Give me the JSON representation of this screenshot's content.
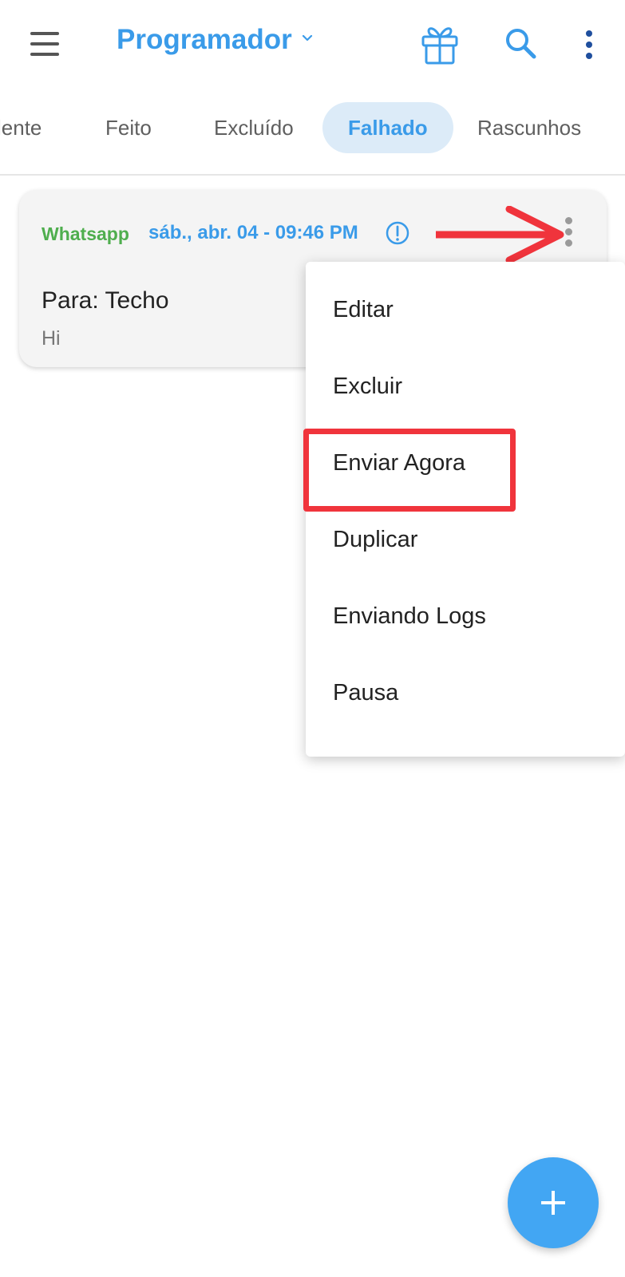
{
  "header": {
    "title": "Programador",
    "icons": {
      "menu": "hamburger-menu-icon",
      "title_dropdown": "chevron-down-icon",
      "gift": "gift-icon",
      "search": "search-icon",
      "more": "more-vertical-icon"
    }
  },
  "tabs": [
    {
      "label": "lente",
      "active": false
    },
    {
      "label": "Feito",
      "active": false
    },
    {
      "label": "Excluído",
      "active": false
    },
    {
      "label": "Falhado",
      "active": true
    },
    {
      "label": "Rascunhos",
      "active": false
    }
  ],
  "card": {
    "source": "Whatsapp",
    "datetime": "sáb., abr. 04 - 09:46 PM",
    "recipient": "Para: Techo",
    "message": "Hi",
    "status_icon": "alert-circle-icon"
  },
  "menu": {
    "items": [
      "Editar",
      "Excluir",
      "Enviar Agora",
      "Duplicar",
      "Enviando Logs",
      "Pausa"
    ],
    "highlighted_index": 2
  },
  "fab": {
    "icon": "plus-icon"
  },
  "colors": {
    "accent": "#3a9be9",
    "whatsapp_green": "#4fae4e",
    "annotation_red": "#f0343c",
    "fab": "#42a6f3"
  }
}
